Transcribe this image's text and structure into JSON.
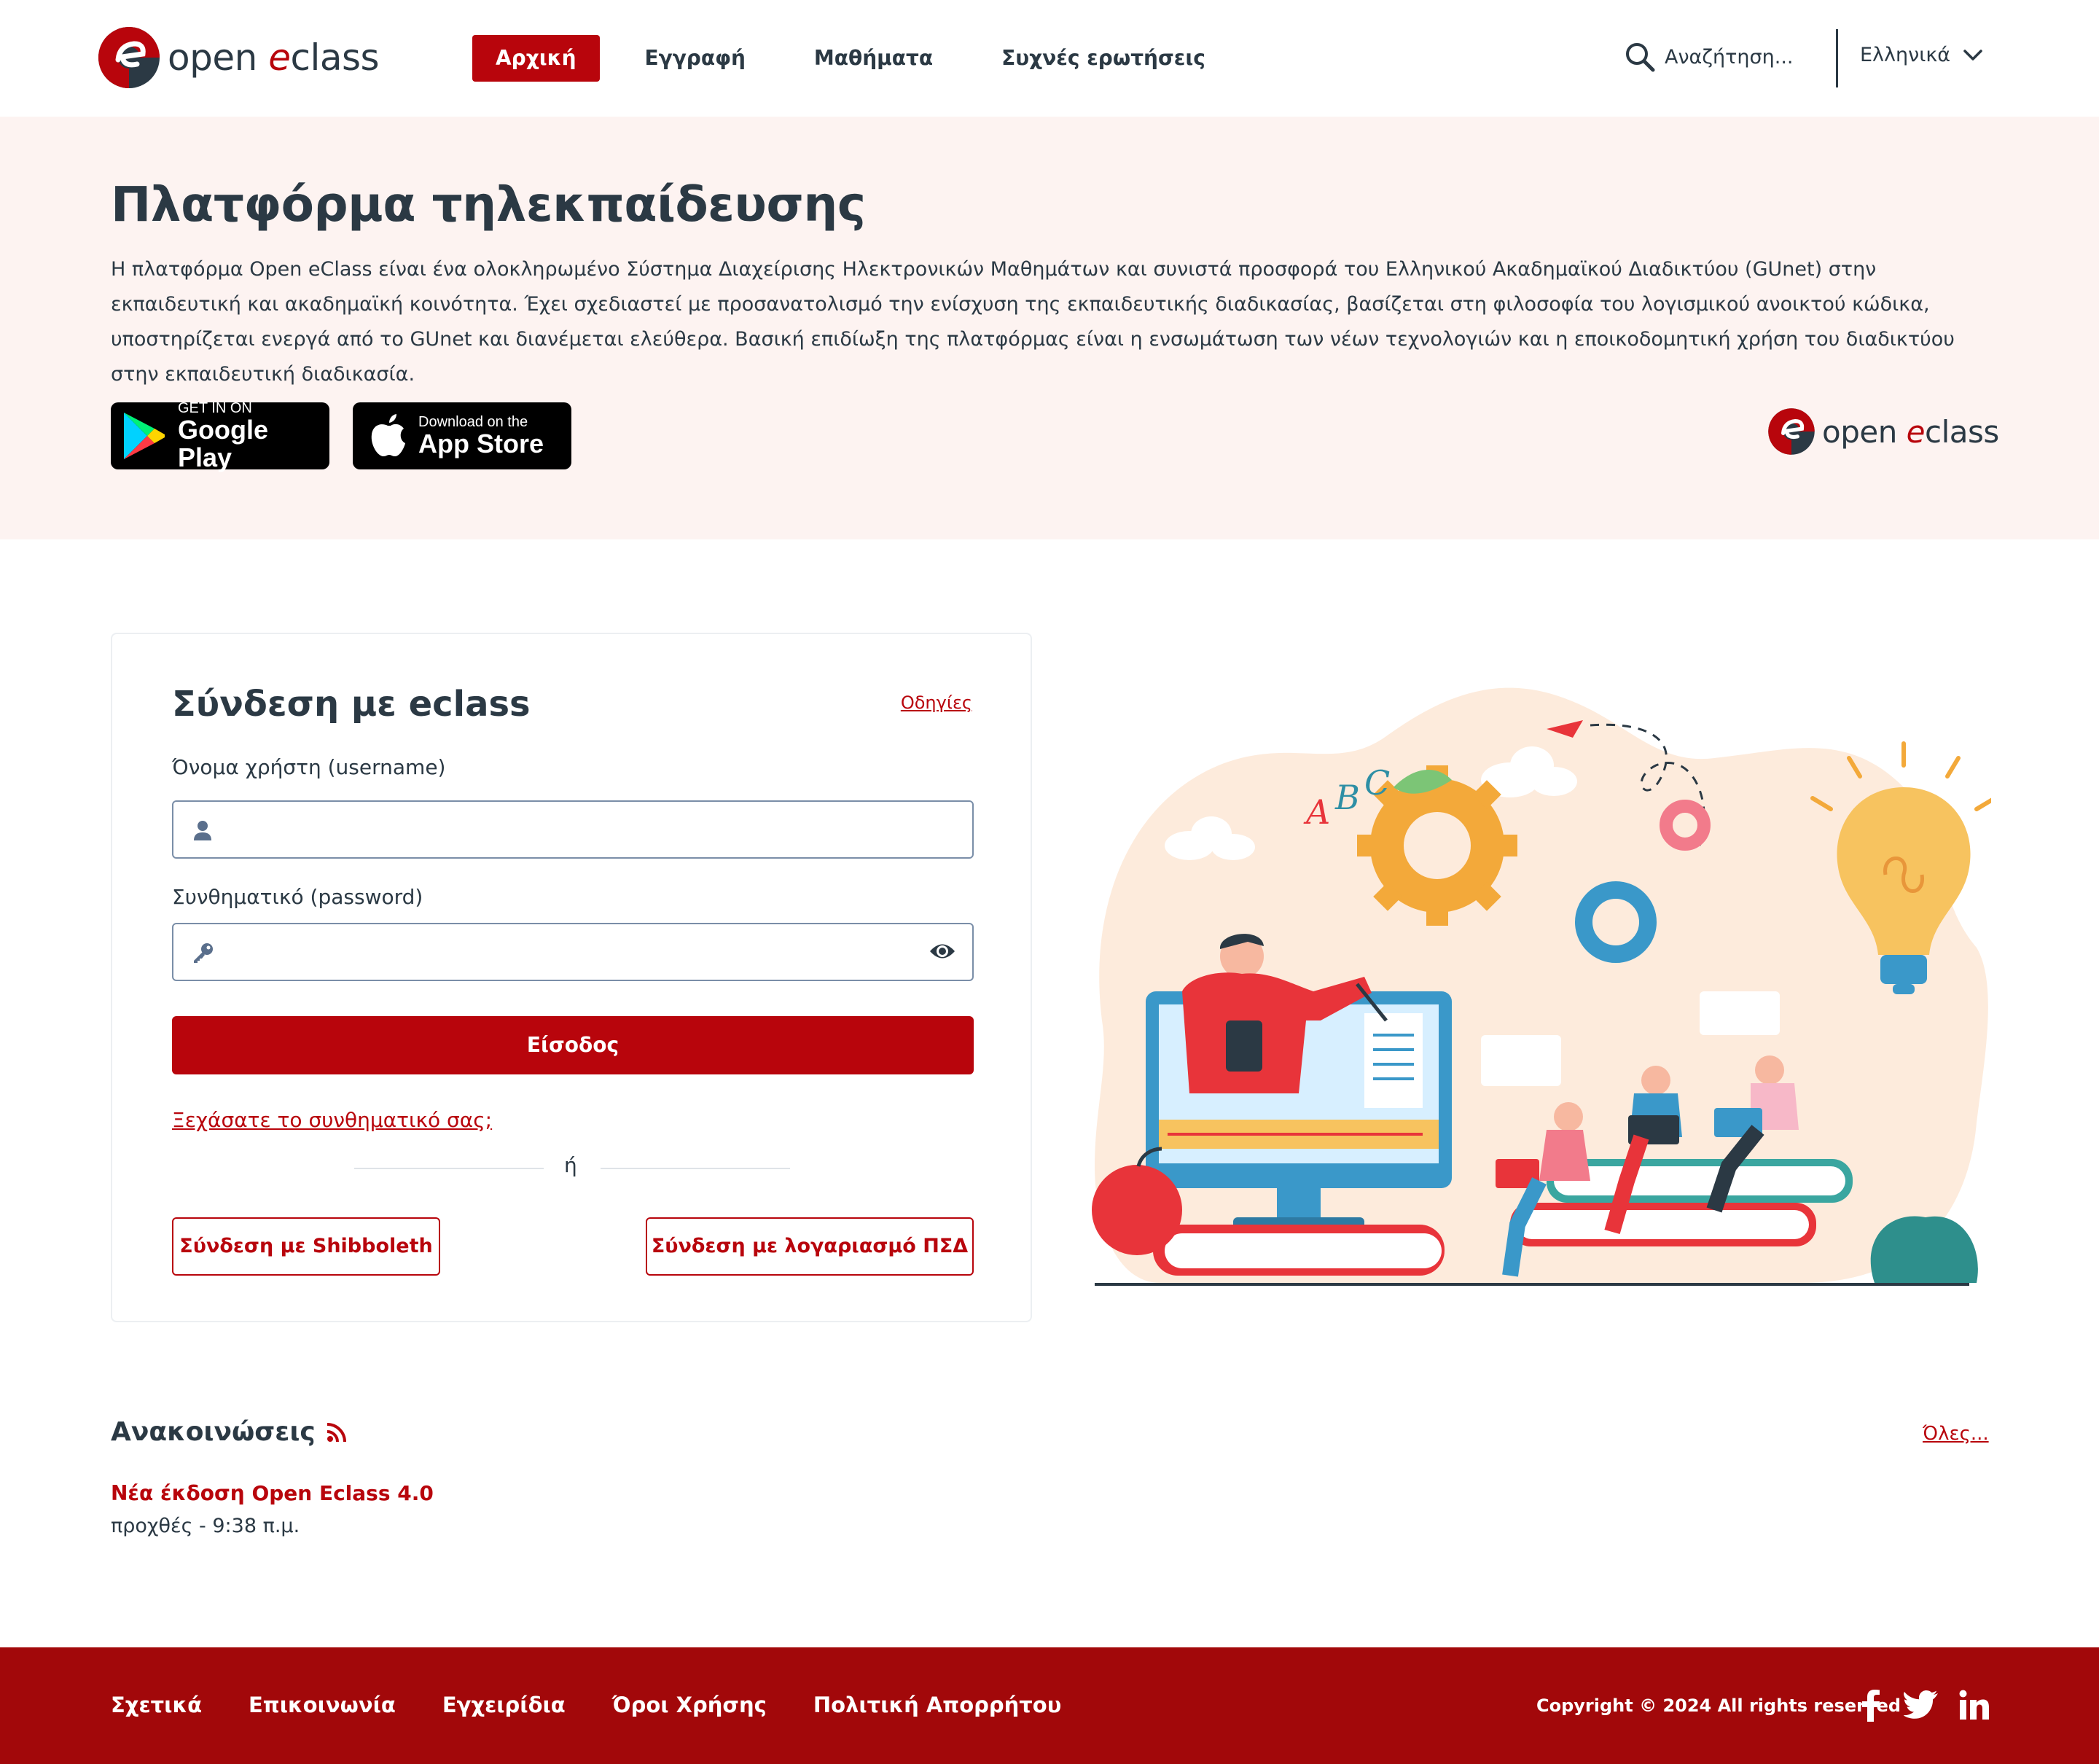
{
  "header": {
    "logo_text_open": "open ",
    "logo_text_e": "e",
    "logo_text_class": "class",
    "nav": [
      {
        "label": "Αρχική",
        "active": true
      },
      {
        "label": "Εγγραφή",
        "active": false
      },
      {
        "label": "Μαθήματα",
        "active": false
      },
      {
        "label": "Συχνές ερωτήσεις",
        "active": false
      }
    ],
    "search_placeholder": "Αναζήτηση...",
    "language": "Ελληνικά"
  },
  "hero": {
    "title": "Πλατφόρμα τηλεκπαίδευσης",
    "description": "Η πλατφόρμα Open eClass είναι ένα ολοκληρωμένο Σύστημα Διαχείρισης Ηλεκτρονικών Μαθημάτων και συνιστά προσφορά του Ελληνικού Ακαδημαϊκού Διαδικτύου (GUnet) στην εκπαιδευτική και ακαδημαϊκή κοινότητα. Έχει σχεδιαστεί με προσανατολισμό την ενίσχυση της εκπαιδευτικής διαδικασίας, βασίζεται στη φιλοσοφία του λογισμικού ανοικτού κώδικα, υποστηρίζεται ενεργά από το GUnet και διανέμεται ελεύθερα. Βασική επιδίωξη της πλατφόρμας είναι η ενσωμάτωση των νέων τεχνολογιών και η εποικοδομητική χρήση του διαδικτύου στην εκπαιδευτική διαδικασία.",
    "google_play_small": "GET IN ON",
    "google_play_big": "Google Play",
    "app_store_small": "Download on the",
    "app_store_big": "App Store"
  },
  "login": {
    "title": "Σύνδεση με eclass",
    "guide_link": "Οδηγίες",
    "username_label": "Όνομα χρήστη (username)",
    "username_value": "",
    "password_label": "Συνθηματικό (password)",
    "password_value": "",
    "submit": "Είσοδος",
    "forgot": "Ξεχάσατε το συνθηματικό σας;",
    "or": "ή",
    "shibboleth": "Σύνδεση με Shibboleth",
    "psd": "Σύνδεση με λογαριασμό ΠΣΔ"
  },
  "announcements": {
    "title": "Ανακοινώσεις",
    "all_link": "Όλες...",
    "items": [
      {
        "title": "Νέα έκδοση Open Eclass 4.0",
        "date": "προχθές - 9:38 π.μ."
      }
    ]
  },
  "footer": {
    "links": [
      "Σχετικά",
      "Επικοινωνία",
      "Εγχειρίδια",
      "Όροι Χρήσης",
      "Πολιτική Απορρήτου"
    ],
    "copyright": "Copyright © 2024 All rights reserved",
    "social": [
      "facebook-icon",
      "twitter-icon",
      "linkedin-icon"
    ]
  },
  "colors": {
    "brand_red": "#b8050c",
    "footer_red": "#a2080a",
    "hero_bg": "#fdf3f1",
    "text_dark": "#2b3944"
  }
}
